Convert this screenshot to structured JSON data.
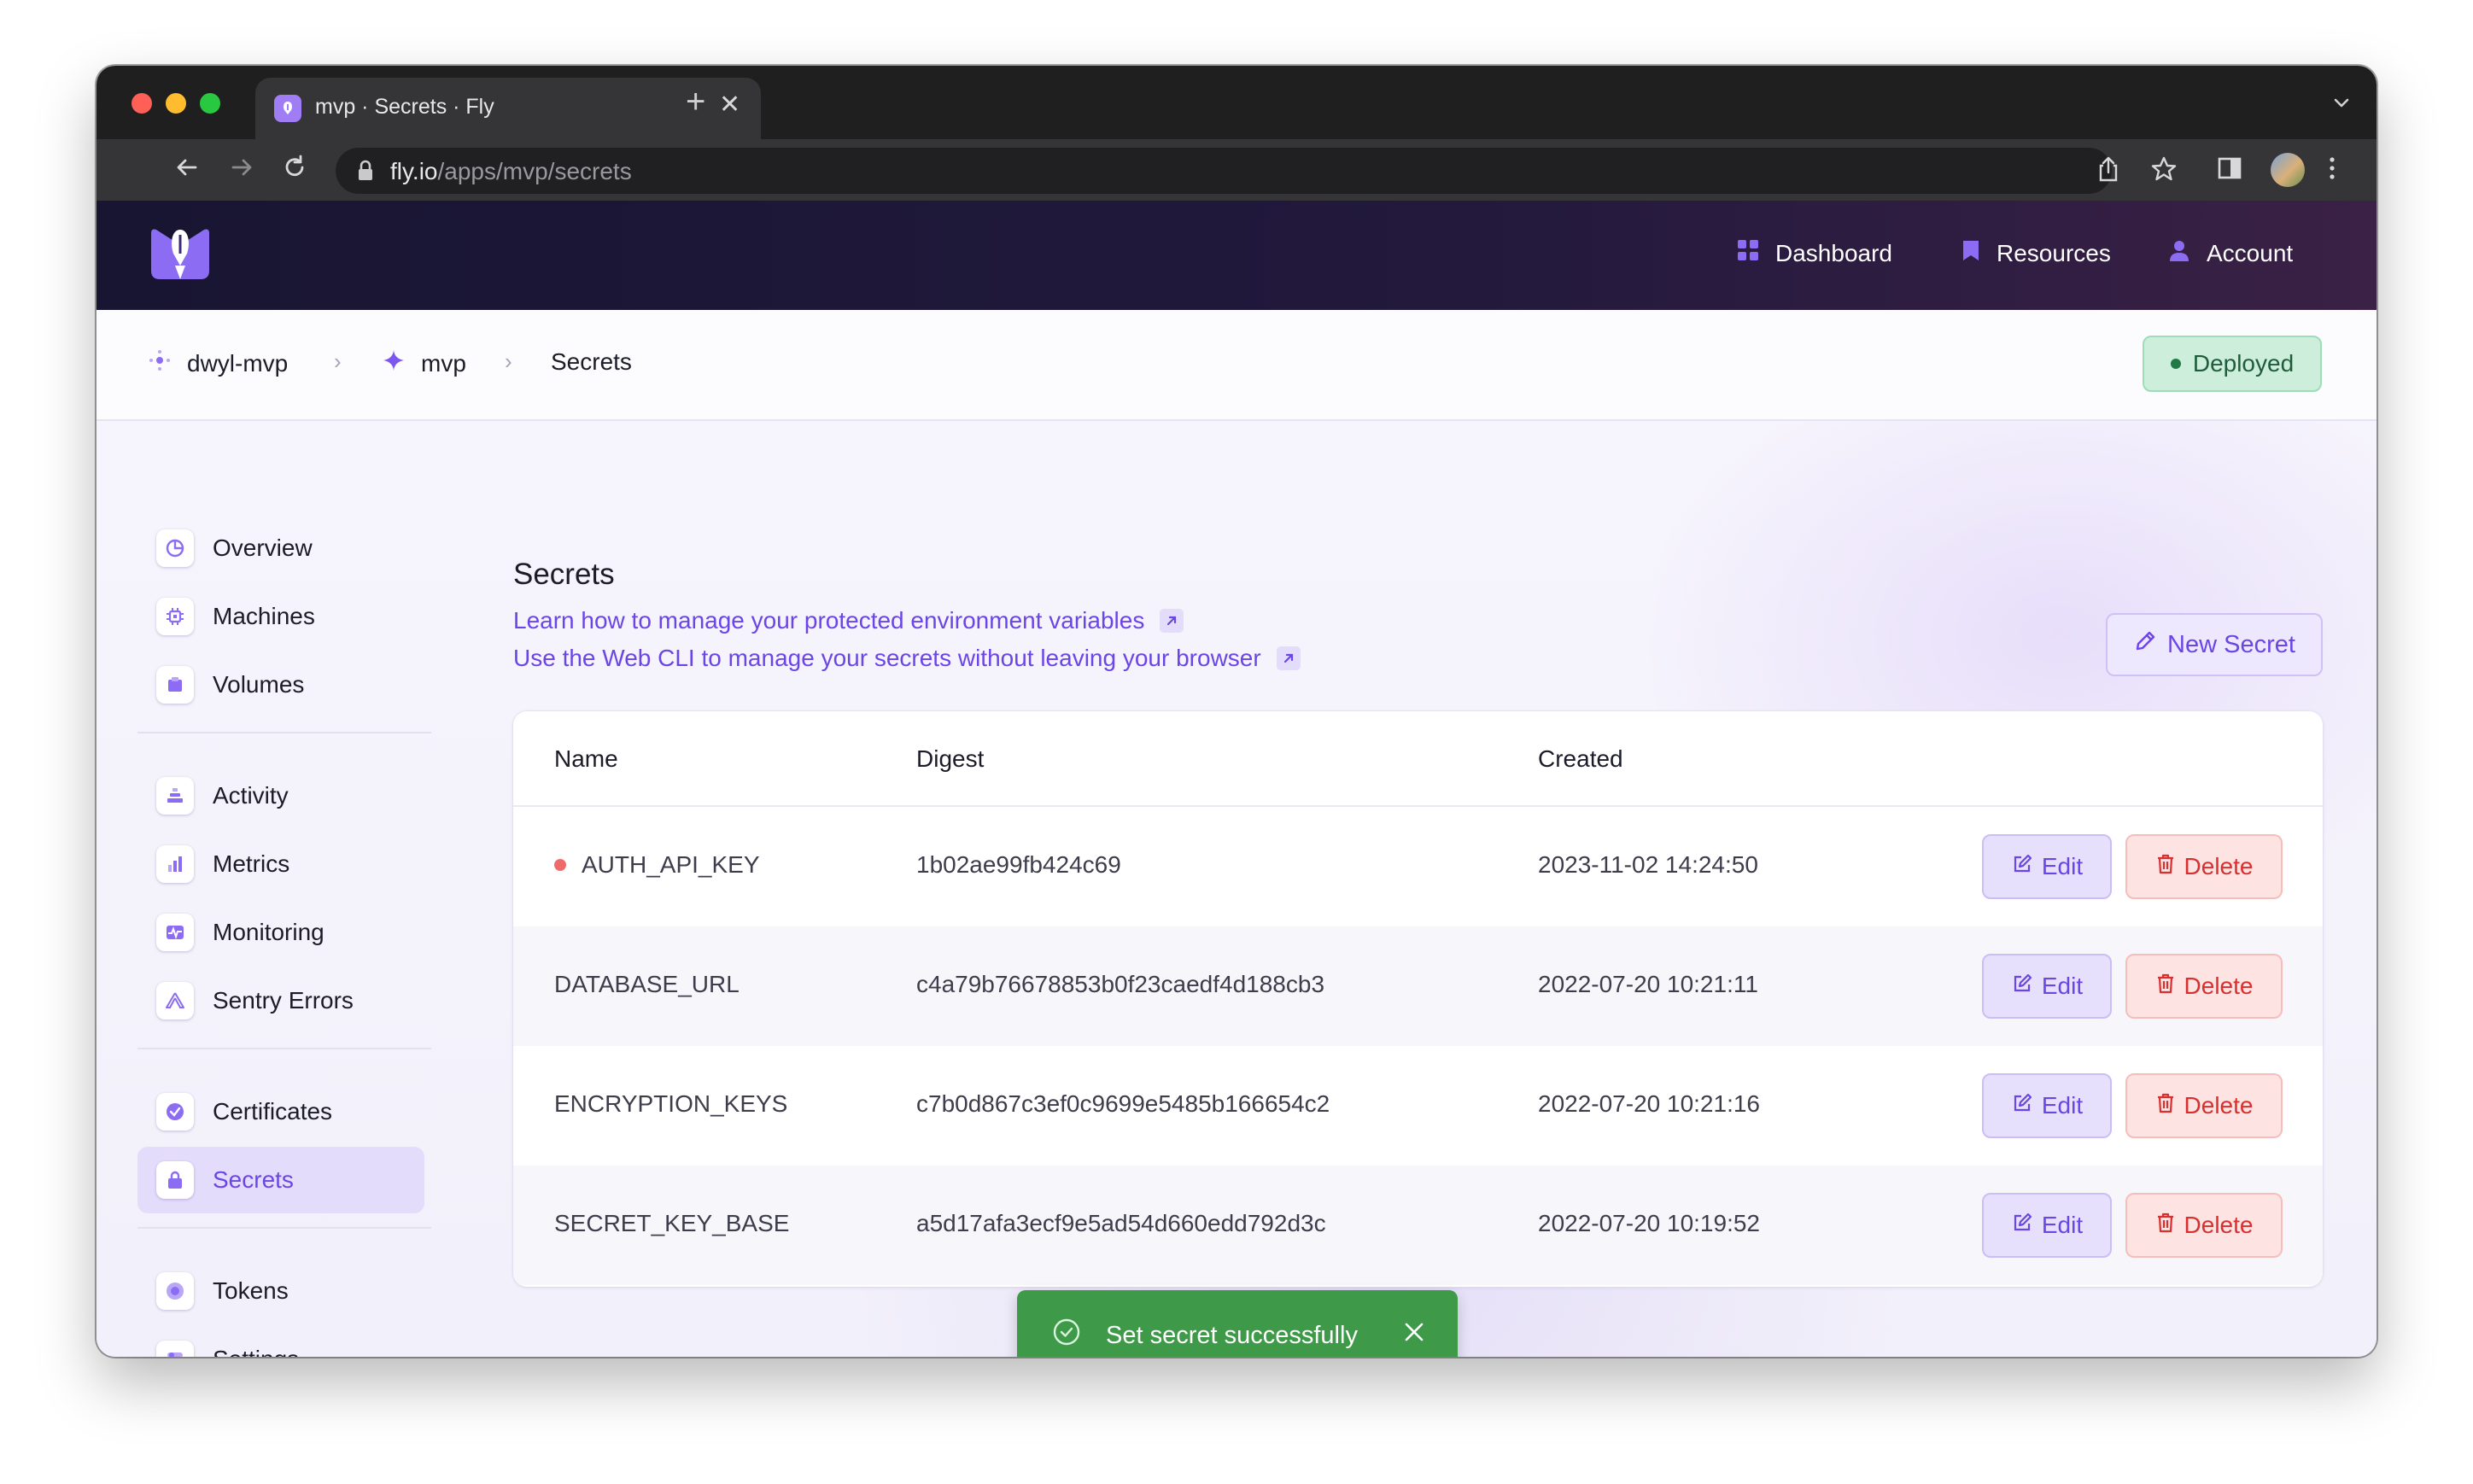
{
  "browser": {
    "tab_title": "mvp · Secrets · Fly",
    "url_host": "fly.io",
    "url_path": "/apps/mvp/secrets",
    "tab_close": "✕",
    "new_tab": "+"
  },
  "topnav": {
    "dashboard": "Dashboard",
    "resources": "Resources",
    "account": "Account"
  },
  "breadcrumb": {
    "org": "dwyl-mvp",
    "app": "mvp",
    "page": "Secrets",
    "separator": "›"
  },
  "status": {
    "label": "Deployed",
    "color": "#1f7a45"
  },
  "sidebar": {
    "items": [
      {
        "label": "Overview",
        "icon": "pie-chart-icon"
      },
      {
        "label": "Machines",
        "icon": "cpu-icon"
      },
      {
        "label": "Volumes",
        "icon": "box-icon"
      },
      {
        "label": "Activity",
        "icon": "layers-icon"
      },
      {
        "label": "Metrics",
        "icon": "bar-chart-icon"
      },
      {
        "label": "Monitoring",
        "icon": "pulse-icon"
      },
      {
        "label": "Sentry Errors",
        "icon": "sentry-icon"
      },
      {
        "label": "Certificates",
        "icon": "badge-check-icon"
      },
      {
        "label": "Secrets",
        "icon": "lock-icon",
        "active": true
      },
      {
        "label": "Tokens",
        "icon": "token-icon"
      },
      {
        "label": "Settings",
        "icon": "toggles-icon"
      }
    ]
  },
  "main": {
    "title": "Secrets",
    "links": [
      "Learn how to manage your protected environment variables",
      "Use the Web CLI to manage your secrets without leaving your browser"
    ],
    "new_secret_label": "New Secret"
  },
  "table": {
    "headers": {
      "name": "Name",
      "digest": "Digest",
      "created": "Created"
    },
    "rows": [
      {
        "name": "AUTH_API_KEY",
        "digest": "1b02ae99fb424c69",
        "created": "2023-11-02 14:24:50",
        "indicator": true
      },
      {
        "name": "DATABASE_URL",
        "digest": "c4a79b76678853b0f23caedf4d188cb3",
        "created": "2022-07-20 10:21:11"
      },
      {
        "name": "ENCRYPTION_KEYS",
        "digest": "c7b0d867c3ef0c9699e5485b166654c2",
        "created": "2022-07-20 10:21:16"
      },
      {
        "name": "SECRET_KEY_BASE",
        "digest": "a5d17afa3ecf9e5ad54d660edd792d3c",
        "created": "2022-07-20 10:19:52"
      }
    ],
    "edit_label": "Edit",
    "delete_label": "Delete"
  },
  "toast": {
    "message": "Set secret successfully",
    "color": "#3e9a48"
  },
  "colors": {
    "accent": "#6b45e6",
    "danger": "#d92f2f"
  }
}
